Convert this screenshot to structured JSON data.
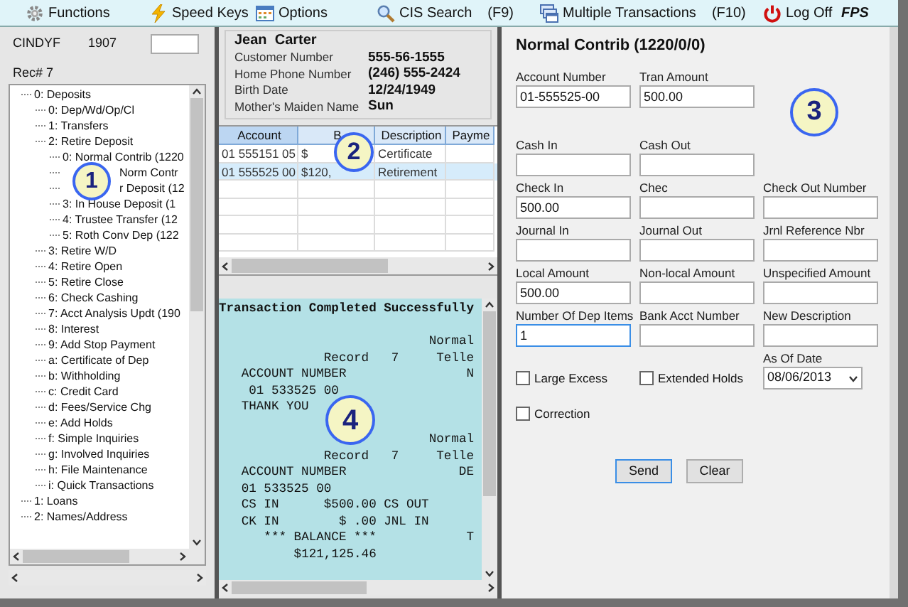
{
  "toolbar": [
    {
      "kind": "gear",
      "label": "Functions"
    },
    {
      "kind": "lightning",
      "label": "Speed Keys"
    },
    {
      "kind": "options",
      "label": "Options"
    },
    {
      "kind": "search",
      "label": "CIS Search",
      "shortcut": "(F9)"
    },
    {
      "kind": "windows",
      "label": "Multiple Transactions",
      "shortcut": "(F10)"
    },
    {
      "kind": "power",
      "label": "Log Off"
    },
    {
      "kind": "brand",
      "label": "FPS"
    }
  ],
  "session": {
    "user": "CINDYF",
    "branch": "1907",
    "record": "Rec# 7"
  },
  "tree": [
    {
      "label": "0: Deposits",
      "children": [
        {
          "label": "0: Dep/Wd/Op/Cl"
        },
        {
          "label": "1: Transfers"
        },
        {
          "label": "2: Retire Deposit",
          "children": [
            {
              "label": "0: Normal Contrib (1220"
            },
            {
              "label": "Norm Contr",
              "kind": "covered"
            },
            {
              "label": "r Deposit (12",
              "kind": "covered"
            },
            {
              "label": "3: In House Deposit (1"
            },
            {
              "label": "4: Trustee Transfer (12"
            },
            {
              "label": "5: Roth Conv Dep (122"
            }
          ]
        },
        {
          "label": "3: Retire W/D"
        },
        {
          "label": "4: Retire Open"
        },
        {
          "label": "5: Retire Close"
        },
        {
          "label": "6: Check Cashing"
        },
        {
          "label": "7: Acct Analysis Updt (190"
        },
        {
          "label": "8: Interest"
        },
        {
          "label": "9: Add Stop Payment"
        },
        {
          "label": "a: Certificate of Dep"
        },
        {
          "label": "b: Withholding"
        },
        {
          "label": "c: Credit Card"
        },
        {
          "label": "d: Fees/Service Chg"
        },
        {
          "label": "e: Add Holds"
        },
        {
          "label": "f: Simple Inquiries"
        },
        {
          "label": "g: Involved Inquiries"
        },
        {
          "label": "h: File Maintenance"
        },
        {
          "label": "i: Quick Transactions"
        }
      ]
    },
    {
      "label": "1: Loans"
    },
    {
      "label": "2: Names/Address"
    }
  ],
  "customer": {
    "name": "Jean  Carter",
    "details": [
      {
        "label": "Customer Number",
        "value": "555-56-1555"
      },
      {
        "label": "Home Phone Number",
        "value": "(246) 555-2424"
      },
      {
        "label": "Birth Date",
        "value": "12/24/1949"
      },
      {
        "label": "Mother's Maiden Name",
        "value": "Sun"
      }
    ]
  },
  "accounts": {
    "columns": [
      "Account",
      "B",
      "Description",
      "Payme"
    ],
    "rows": [
      {
        "cells": [
          "01 555151 05",
          "$",
          "Certificate"
        ],
        "selected": false
      },
      {
        "cells": [
          "01 555525 00",
          "$120,",
          "Retirement"
        ],
        "selected": true
      }
    ]
  },
  "receipt": {
    "title": "Transaction Completed Successfully",
    "body": "\n                            Normal\n              Record   7     Telle\n   ACCOUNT NUMBER                N\n    01 533525 00\n   THANK YOU\n\n                            Normal\n              Record   7     Telle\n   ACCOUNT NUMBER               DE\n   01 533525 00\n   CS IN      $500.00 CS OUT\n   CK IN        $ .00 JNL IN\n      *** BALANCE ***            T\n          $121,125.46"
  },
  "form": {
    "title": "Normal Contrib (1220/0/0)",
    "rows": [
      [
        {
          "kind": "field",
          "label": "Account Number",
          "value": "01-555525-00",
          "focused": false
        },
        {
          "kind": "field",
          "label": "Tran Amount",
          "value": "500.00",
          "focused": false
        }
      ],
      [
        {
          "kind": "field",
          "label": "Cash In",
          "focused": false
        },
        {
          "kind": "field",
          "label": "Cash Out",
          "focused": false
        }
      ],
      [
        {
          "kind": "field",
          "label": "Check In",
          "value": "500.00",
          "focused": false
        },
        {
          "kind": "field",
          "label": "Chec",
          "focused": false
        },
        {
          "kind": "field",
          "label": "Check Out Number",
          "focused": false
        }
      ],
      [
        {
          "kind": "field",
          "label": "Journal In",
          "focused": false
        },
        {
          "kind": "field",
          "label": "Journal Out",
          "focused": false
        },
        {
          "kind": "field",
          "label": "Jrnl Reference Nbr",
          "focused": false
        }
      ],
      [
        {
          "kind": "field",
          "label": "Local Amount",
          "value": "500.00",
          "focused": false
        },
        {
          "kind": "field",
          "label": "Non-local Amount",
          "focused": false
        },
        {
          "kind": "field",
          "label": "Unspecified Amount",
          "focused": false
        }
      ],
      [
        {
          "kind": "field",
          "label": "Number Of Dep Items",
          "value": "1",
          "focused": true
        },
        {
          "kind": "field",
          "label": "Bank Acct Number",
          "focused": false
        },
        {
          "kind": "field",
          "label": "New Description",
          "focused": false
        }
      ],
      [
        {
          "kind": "checkbox",
          "label": "Large Excess",
          "checked": false
        },
        {
          "kind": "checkbox",
          "label": "Extended Holds",
          "checked": false
        },
        {
          "kind": "date",
          "label": "As Of Date",
          "value": "08/06/2013"
        }
      ],
      [
        {
          "kind": "checkbox",
          "label": "Correction",
          "checked": false
        }
      ]
    ],
    "buttons": [
      "Send",
      "Clear"
    ]
  },
  "callouts": [
    "1",
    "2",
    "3",
    "4"
  ]
}
